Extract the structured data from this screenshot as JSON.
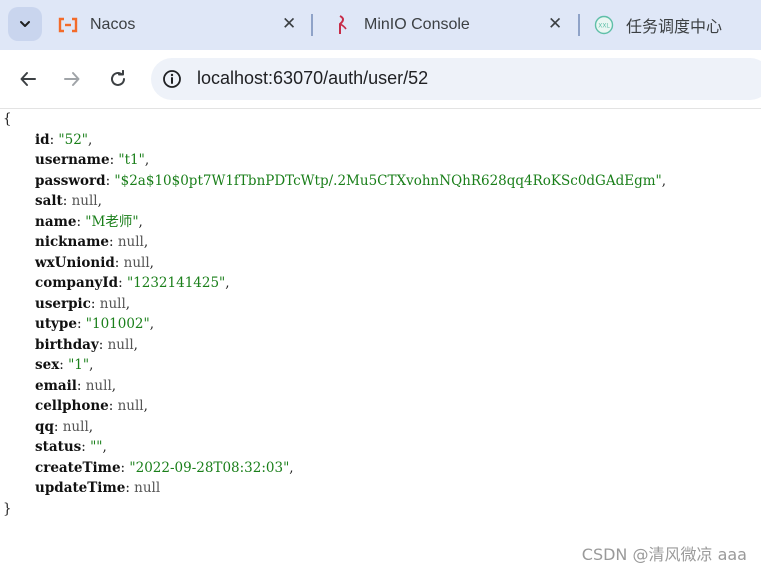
{
  "tabs": [
    {
      "label": "Nacos",
      "icon": "nacos-icon",
      "color": "#f36b2a"
    },
    {
      "label": "MinIO Console",
      "icon": "minio-icon",
      "color": "#c72c48"
    },
    {
      "label": "任务调度中心",
      "icon": "xxl-job-icon",
      "color": "#5fbfa8"
    }
  ],
  "omnibox": {
    "url": "localhost:63070/auth/user/52"
  },
  "json": {
    "open": "{",
    "close": "}",
    "rows": [
      {
        "key": "id",
        "value": "\"52\"",
        "type": "string"
      },
      {
        "key": "username",
        "value": "\"t1\"",
        "type": "string"
      },
      {
        "key": "password",
        "value": "\"$2a$10$0pt7W1fTbnPDTcWtp/.2Mu5CTXvohnNQhR628qq4RoKSc0dGAdEgm\"",
        "type": "string"
      },
      {
        "key": "salt",
        "value": "null",
        "type": "null"
      },
      {
        "key": "name",
        "value": "\"M老师\"",
        "type": "string"
      },
      {
        "key": "nickname",
        "value": "null",
        "type": "null"
      },
      {
        "key": "wxUnionid",
        "value": "null",
        "type": "null"
      },
      {
        "key": "companyId",
        "value": "\"1232141425\"",
        "type": "string"
      },
      {
        "key": "userpic",
        "value": "null",
        "type": "null"
      },
      {
        "key": "utype",
        "value": "\"101002\"",
        "type": "string"
      },
      {
        "key": "birthday",
        "value": "null",
        "type": "null"
      },
      {
        "key": "sex",
        "value": "\"1\"",
        "type": "string"
      },
      {
        "key": "email",
        "value": "null",
        "type": "null"
      },
      {
        "key": "cellphone",
        "value": "null",
        "type": "null"
      },
      {
        "key": "qq",
        "value": "null",
        "type": "null"
      },
      {
        "key": "status",
        "value": "\"\"",
        "type": "string"
      },
      {
        "key": "createTime",
        "value": "\"2022-09-28T08:32:03\"",
        "type": "string"
      },
      {
        "key": "updateTime",
        "value": "null",
        "type": "null"
      }
    ]
  },
  "watermark": "CSDN @清风微凉 aaa"
}
